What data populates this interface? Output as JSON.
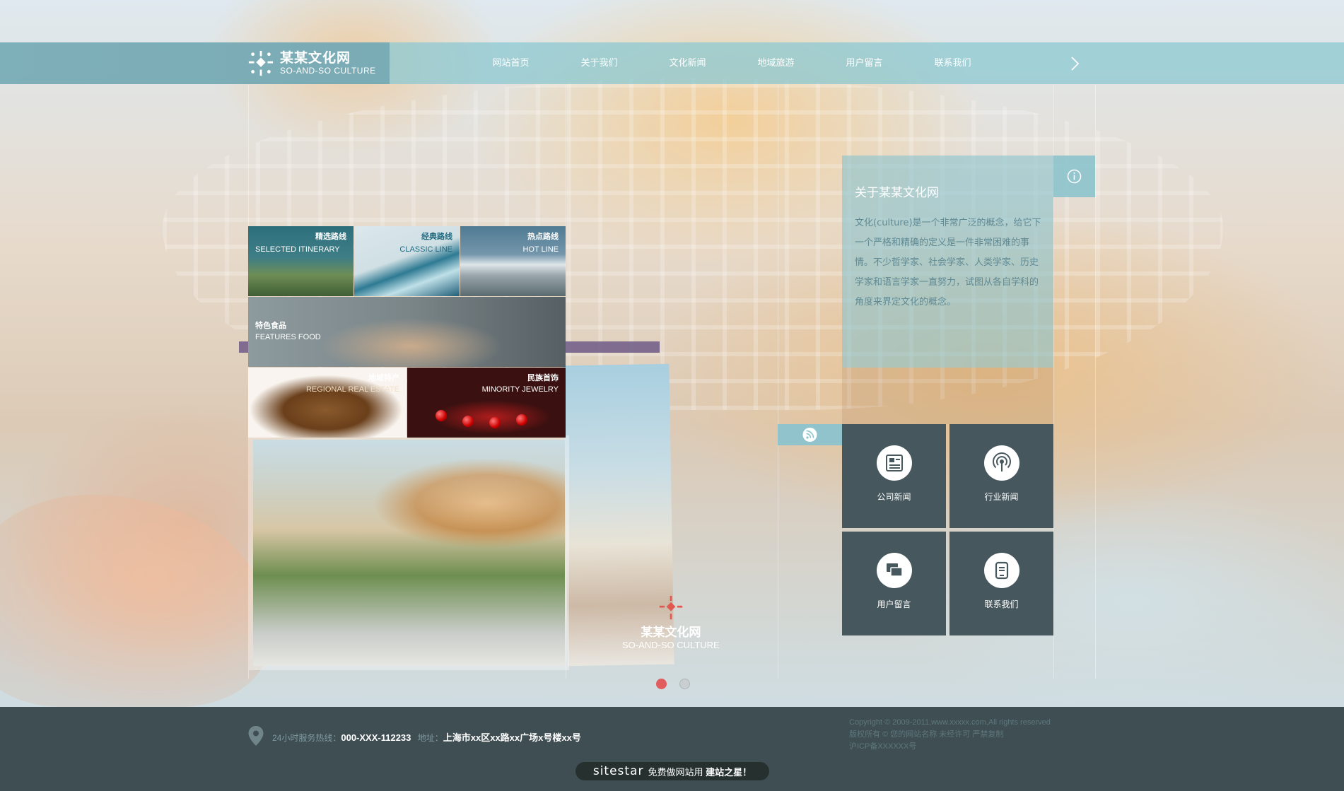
{
  "brand": {
    "name_cn": "某某文化网",
    "name_en": "SO-AND-SO CULTURE"
  },
  "nav": {
    "items": [
      "网站首页",
      "关于我们",
      "文化新闻",
      "地域旅游",
      "用户留言",
      "联系我们"
    ],
    "next_icon": "chevron-right-icon"
  },
  "collage": {
    "selected": {
      "cn": "精选路线",
      "en": "SELECTED ITINERARY"
    },
    "classic": {
      "cn": "经典路线",
      "en": "CLASSIC LINE"
    },
    "hot": {
      "cn": "热点路线",
      "en": "HOT LINE"
    },
    "food": {
      "cn": "特色食品",
      "en": "FEATURES FOOD"
    },
    "estate": {
      "cn": "地域特产",
      "en": "REGIONAL REAL ESTATE"
    },
    "jewel": {
      "cn": "民族首饰",
      "en": "MINORITY JEWELRY"
    }
  },
  "slider": {
    "total": 2,
    "active": 1
  },
  "about": {
    "title": "关于某某文化网",
    "body": "文化(culture)是一个非常广泛的概念，给它下一个严格和精确的定义是一件非常困难的事情。不少哲学家、社会学家、人类学家、历史学家和语言学家一直努力，试图从各自学科的角度来界定文化的概念。",
    "info_icon": "info-icon"
  },
  "news": {
    "rss_icon": "rss-icon",
    "cells": [
      {
        "label": "公司新闻",
        "icon": "newspaper-icon"
      },
      {
        "label": "行业新闻",
        "icon": "broadcast-icon"
      },
      {
        "label": "用户留言",
        "icon": "chat-icon"
      },
      {
        "label": "联系我们",
        "icon": "contact-icon"
      }
    ]
  },
  "footer": {
    "hotline_label": "24小时服务热线：",
    "hotline": "000-XXX-112233",
    "address_label": "地址：",
    "address": "上海市xx区xx路xx广场x号楼xx号",
    "copyright": "Copyright © 2009-2011,www.xxxxx.com,All rights reserved",
    "rights": "版权所有 © 您的网站名称 未经许可 严禁复制",
    "icp": "沪ICP备XXXXXX号",
    "badge_brand": "sitestar",
    "badge_text": "免费做网站用",
    "badge_strong": "建站之星！"
  },
  "colors": {
    "nav_bg": "#8cc8d2",
    "panel": "#8cc3cd",
    "grid": "#46585e",
    "footer": "#3f4e52",
    "accent_dot": "#e15c5c"
  }
}
